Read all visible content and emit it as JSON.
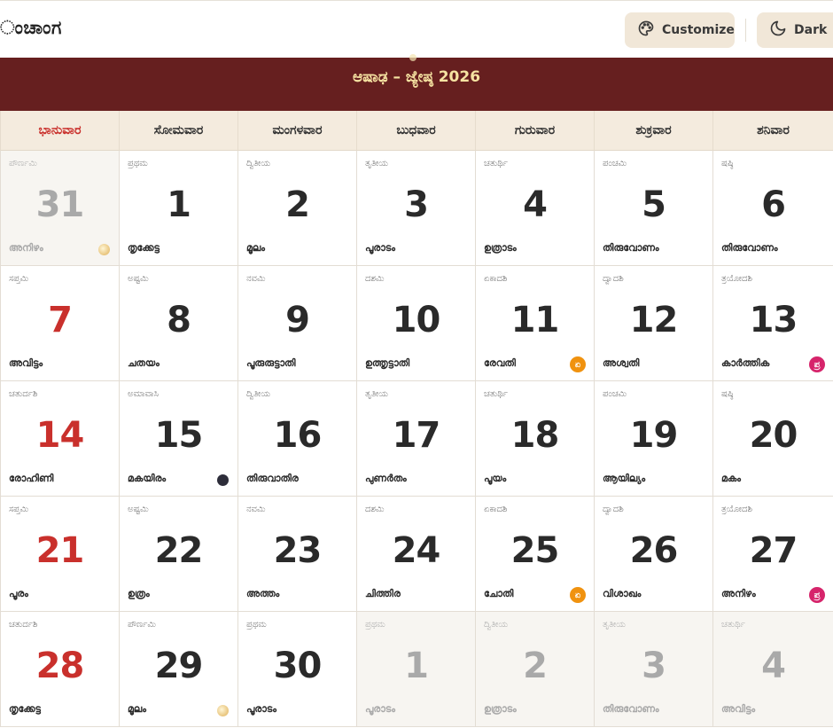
{
  "header": {
    "brand": "ಂಚಾಂಗ",
    "customize_label": "Customize",
    "dark_label": "Dark"
  },
  "calendar": {
    "title": "ಆಷಾಢ – ಜ್ಯೇಷ್ಠ 2026",
    "weekdays": [
      "ಭಾನುವಾರ",
      "ಸೋಮವಾರ",
      "ಮಂಗಳವಾರ",
      "ಬುಧವಾರ",
      "ಗುರುವಾರ",
      "ಶುಕ್ರವಾರ",
      "ಶನಿವಾರ"
    ],
    "days": [
      {
        "tithi": "ಪೌರ್ಣಮಿ",
        "num": "31",
        "star": "അനിഴം",
        "other": true,
        "sun": true,
        "moon": "full"
      },
      {
        "tithi": "ಪ್ರಥಮ",
        "num": "1",
        "star": "തൃക്കേട്ട"
      },
      {
        "tithi": "ದ್ವಿತೀಯ",
        "num": "2",
        "star": "മൂലം"
      },
      {
        "tithi": "ತೃತೀಯ",
        "num": "3",
        "star": "പൂരാടം"
      },
      {
        "tithi": "ಚತುರ್ಥಿ",
        "num": "4",
        "star": "ഉത്രാടം"
      },
      {
        "tithi": "ಪಂಚಮಿ",
        "num": "5",
        "star": "തിരുവോണം"
      },
      {
        "tithi": "ಷಷ್ಠಿ",
        "num": "6",
        "star": "തിരുവോണം"
      },
      {
        "tithi": "ಸಪ್ತಮಿ",
        "num": "7",
        "star": "അവിട്ടം",
        "sun": true
      },
      {
        "tithi": "ಅಷ್ಟಮಿ",
        "num": "8",
        "star": "ചതയം"
      },
      {
        "tithi": "ನವಮಿ",
        "num": "9",
        "star": "പൂരുരുട്ടാതി"
      },
      {
        "tithi": "ದಶಮಿ",
        "num": "10",
        "star": "ഉത്തൃട്ടാതി"
      },
      {
        "tithi": "ಏಕಾದಶಿ",
        "num": "11",
        "star": "രേവതി",
        "badge": "ekadashi",
        "badge_text": "ಏ"
      },
      {
        "tithi": "ದ್ವಾದಶಿ",
        "num": "12",
        "star": "അശ്വതി"
      },
      {
        "tithi": "ತ್ರಯೋದಶಿ",
        "num": "13",
        "star": "കാർത്തിക",
        "badge": "pradosh",
        "badge_text": "ಪ್ರ"
      },
      {
        "tithi": "ಚತುರ್ದಶಿ",
        "num": "14",
        "star": "രോഹിണി",
        "sun": true
      },
      {
        "tithi": "ಅಮಾವಾಸಿ",
        "num": "15",
        "star": "മകയിരം",
        "moon": "new"
      },
      {
        "tithi": "ದ್ವಿತೀಯ",
        "num": "16",
        "star": "തിരുവാതിര"
      },
      {
        "tithi": "ತೃತೀಯ",
        "num": "17",
        "star": "പുണർതം"
      },
      {
        "tithi": "ಚತುರ್ಥಿ",
        "num": "18",
        "star": "പൂയം"
      },
      {
        "tithi": "ಪಂಚಮಿ",
        "num": "19",
        "star": "ആയില്യം"
      },
      {
        "tithi": "ಷಷ್ಠಿ",
        "num": "20",
        "star": "മകം"
      },
      {
        "tithi": "ಸಪ್ತಮಿ",
        "num": "21",
        "star": "പൂരം",
        "sun": true
      },
      {
        "tithi": "ಅಷ್ಟಮಿ",
        "num": "22",
        "star": "ഉത്രം"
      },
      {
        "tithi": "ನವಮಿ",
        "num": "23",
        "star": "അത്തം"
      },
      {
        "tithi": "ದಶಮಿ",
        "num": "24",
        "star": "ചിത്തിര"
      },
      {
        "tithi": "ಏಕಾದಶಿ",
        "num": "25",
        "star": "ചോതി",
        "badge": "ekadashi",
        "badge_text": "ಏ"
      },
      {
        "tithi": "ದ್ವಾದಶಿ",
        "num": "26",
        "star": "വിശാഖം"
      },
      {
        "tithi": "ತ್ರಯೋದಶಿ",
        "num": "27",
        "star": "അനിഴം",
        "badge": "pradosh",
        "badge_text": "ಪ್ರ"
      },
      {
        "tithi": "ಚತುರ್ದಶಿ",
        "num": "28",
        "star": "തൃക്കേട്ട",
        "sun": true
      },
      {
        "tithi": "ಪೌರ್ಣಮಿ",
        "num": "29",
        "star": "മൂലം",
        "moon": "full"
      },
      {
        "tithi": "ಪ್ರಥಮ",
        "num": "30",
        "star": "പൂരാടം"
      },
      {
        "tithi": "ಪ್ರಥಮ",
        "num": "1",
        "star": "പൂരാടം",
        "other": true
      },
      {
        "tithi": "ದ್ವಿತೀಯ",
        "num": "2",
        "star": "ഉത്രാടം",
        "other": true
      },
      {
        "tithi": "ತೃತೀಯ",
        "num": "3",
        "star": "തിരുവോണം",
        "other": true
      },
      {
        "tithi": "ಚತುರ್ಥಿ",
        "num": "4",
        "star": "അവിട്ടം",
        "other": true
      }
    ]
  }
}
